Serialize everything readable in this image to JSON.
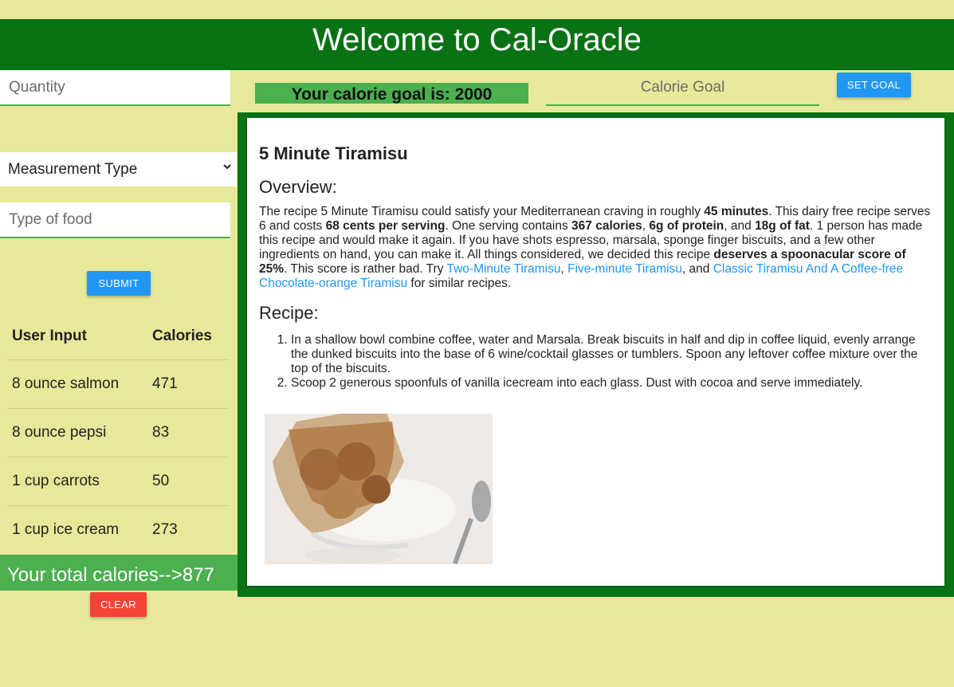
{
  "header": {
    "title": "Welcome to Cal-Oracle"
  },
  "form": {
    "quantity_placeholder": "Quantity",
    "measurement_placeholder": "Measurement Type",
    "food_placeholder": "Type of food",
    "submit_label": "SUBMIT"
  },
  "table": {
    "headers": [
      "User Input",
      "Calories"
    ],
    "rows": [
      {
        "input": "8 ounce salmon",
        "calories": "471"
      },
      {
        "input": "8 ounce pepsi",
        "calories": "83"
      },
      {
        "input": "1 cup carrots",
        "calories": "50"
      },
      {
        "input": "1 cup ice cream",
        "calories": "273"
      }
    ]
  },
  "total": {
    "text": "Your total calories-->877"
  },
  "clear_label": "CLEAR",
  "goal": {
    "banner": "Your calorie goal is: 2000",
    "placeholder": "Calorie Goal",
    "set_label": "SET GOAL"
  },
  "recipe": {
    "title": "5 Minute Tiramisu",
    "overview_heading": "Overview:",
    "overview": {
      "t1": "The recipe 5 Minute Tiramisu could satisfy your Mediterranean craving in roughly ",
      "b1": "45 minutes",
      "t2": ". This dairy free recipe serves 6 and costs ",
      "b2": "68 cents per serving",
      "t3": ". One serving contains ",
      "b3": "367 calories",
      "t4": ", ",
      "b4": "6g of protein",
      "t5": ", and ",
      "b5": "18g of fat",
      "t6": ". 1 person has made this recipe and would make it again. If you have shots espresso, marsala, sponge finger biscuits, and a few other ingredients on hand, you can make it. All things considered, we decided this recipe ",
      "b6": "deserves a spoonacular score of 25%",
      "t7": ". This score is rather bad. Try ",
      "link1": "Two-Minute Tiramisu",
      "t8": ", ",
      "link2": "Five-minute Tiramisu",
      "t9": ", and ",
      "link3": "Classic Tiramisu And A Coffee-free Chocolate-orange Tiramisu",
      "t10": " for similar recipes."
    },
    "recipe_heading": "Recipe:",
    "steps": [
      "In a shallow bowl combine coffee, water and Marsala. Break biscuits in half and dip in coffee liquid, evenly arrange the dunked biscuits into the base of 6 wine/cocktail glasses or tumblers. Spoon any leftover coffee mixture over the top of the biscuits.",
      "Scoop 2 generous spoonfuls of vanilla icecream into each glass. Dust with cocoa and serve immediately."
    ]
  },
  "colors": {
    "background": "#e8e89a",
    "header_green": "#087215",
    "accent_green": "#4caf50",
    "button_blue": "#2196f3",
    "button_red": "#f44336"
  }
}
